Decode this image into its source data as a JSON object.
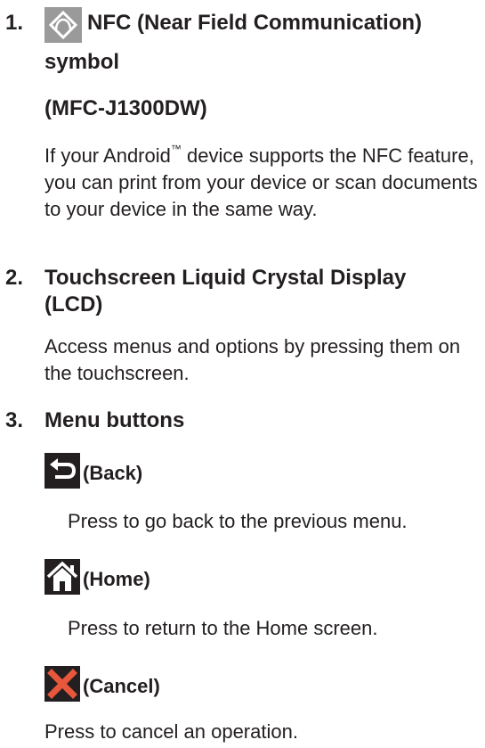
{
  "items": [
    {
      "number": "1.",
      "heading_line1": "NFC (Near Field Communication)",
      "heading_line2": "symbol",
      "model": "(MFC-J1300DW)",
      "body_prefix": "If your Android",
      "body_tm": "™",
      "body_rest": " device supports the NFC feature, you can print from your device or scan documents to your device in the same way."
    },
    {
      "number": "2.",
      "heading_line1": "Touchscreen Liquid Crystal Display",
      "heading_line2": "(LCD)",
      "body": "Access menus and options by pressing them on the touchscreen."
    },
    {
      "number": "3.",
      "heading_line1": "Menu buttons",
      "buttons": [
        {
          "label": "(Back)",
          "icon": "back-arrow-icon",
          "description": "Press to go back to the previous menu."
        },
        {
          "label": "(Home)",
          "icon": "home-icon",
          "description": "Press to return to the Home screen."
        },
        {
          "label": "(Cancel)",
          "icon": "cancel-x-icon",
          "description": "Press to cancel an operation."
        }
      ]
    }
  ],
  "colors": {
    "text": "#231f20",
    "icon_dark": "#231f20",
    "cancel": "#e8563c"
  }
}
